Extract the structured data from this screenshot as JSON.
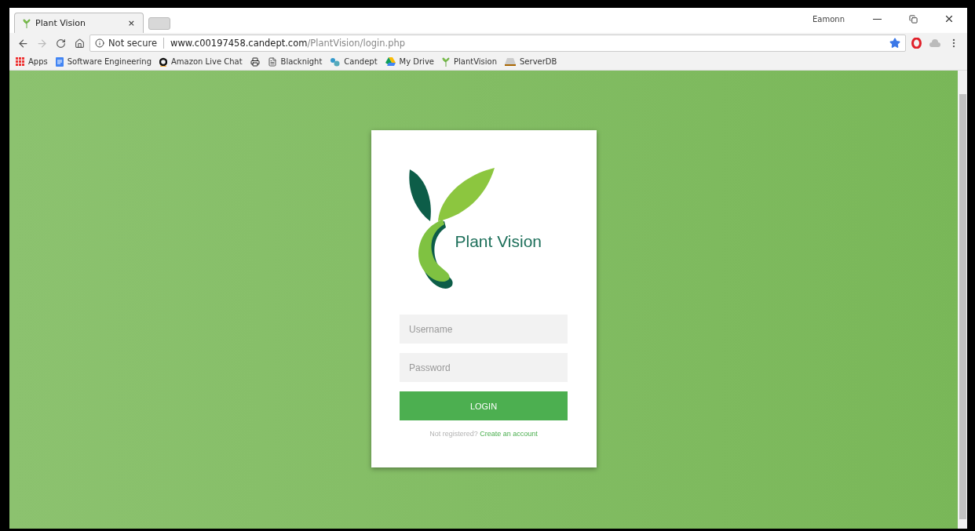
{
  "tab": {
    "title": "Plant Vision",
    "close": "×"
  },
  "profile": "Eamonn",
  "address": {
    "security": "Not secure",
    "host": "www.c00197458.candept.com",
    "path": "/PlantVision/login.php"
  },
  "bookmarks": [
    "Apps",
    "Software Engineering",
    "Amazon Live Chat",
    "Blacknight",
    "Candept",
    "My Drive",
    "PlantVision",
    "ServerDB"
  ],
  "login": {
    "logo_text": "Plant Vision",
    "username": {
      "placeholder": "Username"
    },
    "password": {
      "placeholder": "Password"
    },
    "button": "LOGIN",
    "prompt": "Not registered?",
    "link": "Create an account"
  }
}
